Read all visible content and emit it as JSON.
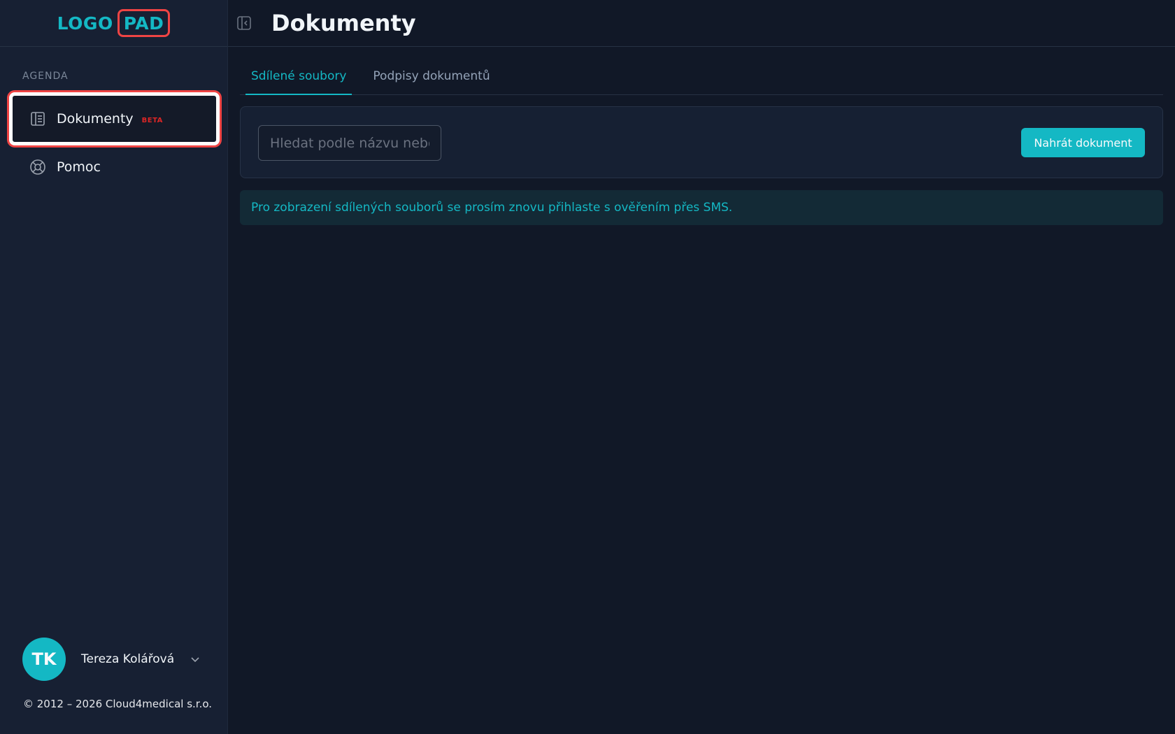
{
  "brand": {
    "logo_left": "LOGO",
    "logo_right": "PAD",
    "accent_color": "#14b8c4",
    "highlight_color": "#ef4444"
  },
  "sidebar": {
    "section_label": "AGENDA",
    "items": [
      {
        "label": "Dokumenty",
        "badge": "BETA",
        "icon": "document-list-icon",
        "active": true
      },
      {
        "label": "Pomoc",
        "icon": "lifebuoy-icon",
        "active": false
      }
    ],
    "user": {
      "initials": "TK",
      "name": "Tereza Kolářová"
    },
    "copyright": "© 2012 – 2026 Cloud4medical s.r.o."
  },
  "header": {
    "title": "Dokumenty",
    "collapse_icon": "sidebar-collapse-icon"
  },
  "main": {
    "tabs": [
      {
        "label": "Sdílené soubory",
        "active": true
      },
      {
        "label": "Podpisy dokumentů",
        "active": false
      }
    ],
    "search": {
      "placeholder": "Hledat podle názvu nebo",
      "value": ""
    },
    "upload_button": "Nahrát dokument",
    "alert": "Pro zobrazení sdílených souborů se prosím znovu přihlaste s ověřením přes SMS."
  }
}
